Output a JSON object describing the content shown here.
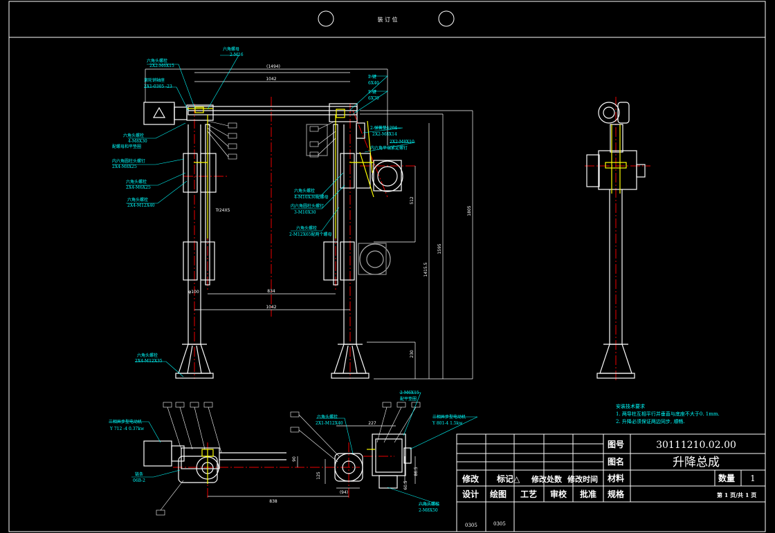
{
  "header": {
    "binding_label": "装 订 位"
  },
  "title_block": {
    "drawing_no_label": "图号",
    "drawing_no": "30111210.02.00",
    "name_label": "图名",
    "name": "升降总成",
    "material_label": "材料",
    "quantity_label": "数量",
    "quantity": "1",
    "spec_label": "规格",
    "sheet": "第 1 页/共 1 页",
    "revision_headers": [
      "修改",
      "标记△",
      "修改处数",
      "修改时间"
    ],
    "sign_headers": [
      "设计",
      "绘图",
      "工艺",
      "审校",
      "批准"
    ],
    "dates": [
      "0305",
      "0305"
    ]
  },
  "notes": {
    "title": "安装技术要求",
    "lines": [
      "1. 两导柱互相平行并垂直与底座不大于0. 1mm.",
      "2. 升降必须保证两边同步, 顺畅."
    ]
  },
  "dimensions": {
    "front_overall": "(1494)",
    "front_top": "1042",
    "front_inner": "834",
    "front_bottom": "1042",
    "col_dia": "φ100",
    "rod": "Tr24X5",
    "h_total": "1805",
    "h_1595": "1595",
    "h_1415": "1415.5",
    "h_512": "512",
    "h_230": "230",
    "plan_838": "838",
    "plan_227": "227",
    "plan_125": "125",
    "plan_90": "90",
    "plan_94": "(94)",
    "plan_865": "86.5",
    "plan_605": "60.5"
  },
  "callouts": {
    "c1": "六角头螺栓",
    "c1b": "2X2-M6X15",
    "c2": "六角螺母",
    "c2b": "2-M16",
    "c3": "滚轮销轴座",
    "c3b": "2X1-0305 -23",
    "c4": "六角头螺栓",
    "c4b": "4-M8X30",
    "c4c": "配螺母和平垫圈",
    "c5": "内六角圆柱头螺钉",
    "c5b": "2X4-M8X25",
    "c6": "六角头螺栓",
    "c6b": "2X4-M6X25",
    "c7": "六角头螺栓",
    "c7b": "2X4-M12X40",
    "r1": "2-键",
    "r1b": "6X40",
    "r2": "2-键",
    "r2b": "6X70",
    "r3": "2-弹簧垫1204",
    "r3b": "2X2-M8X14",
    "r4": "2X2-M8X10",
    "r4b": "内六角平端紧定螺钉",
    "r5": "六角头螺栓",
    "r5b": "4-M10X30配螺母",
    "r6": "内六角圆柱头螺钉",
    "r6b": "3-M10X30",
    "r7": "六角头螺栓",
    "r7b": "2-M12X65配两个螺母",
    "b1": "六角头螺栓",
    "b1b": "2X4-M12X35",
    "p1": "三相异步型电动机",
    "p1b": "Y 712 -4   0.37kw",
    "p2": "链条",
    "p2b": "06B-2",
    "p3": "六角头螺栓",
    "p3b": "2X1-M12X40",
    "p4": "2-M6X15",
    "p4b": "配平垫圈",
    "p5": "三相异步型电动机",
    "p5b": "Y 801-4  1.5kw",
    "p6": "六角头螺栓",
    "p6b": "2-M8X50"
  }
}
